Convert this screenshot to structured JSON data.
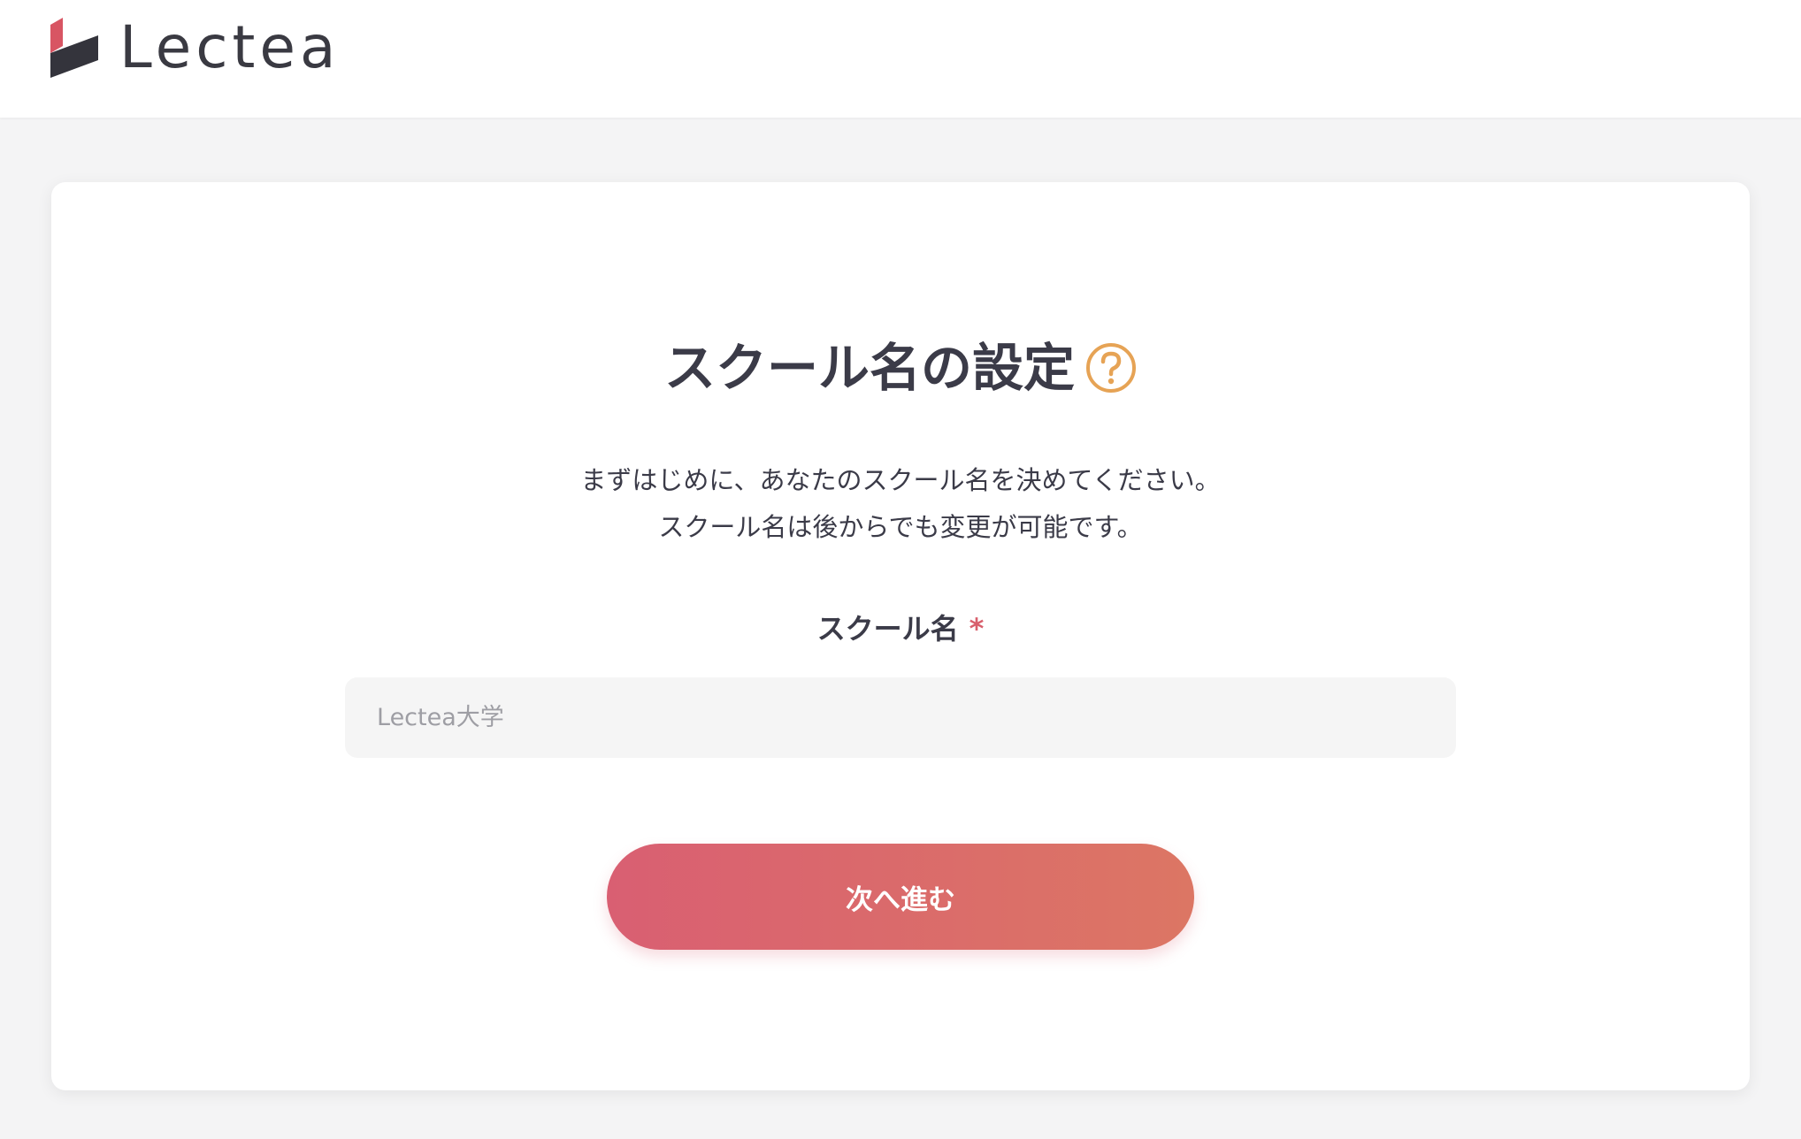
{
  "header": {
    "logo_text": "Lectea"
  },
  "main": {
    "title": "スクール名の設定",
    "description_lines": [
      "まずはじめに、あなたのスクール名を決めてください。",
      "スクール名は後からでも変更が可能です。"
    ],
    "field": {
      "label": "スクール名",
      "required_mark": "*",
      "placeholder": "Lectea大学",
      "value": ""
    },
    "next_button_label": "次へ進む"
  },
  "colors": {
    "accent_gradient_start": "#d95f72",
    "accent_gradient_end": "#dc7664",
    "help_icon": "#e6a355",
    "required": "#d85f6c",
    "text": "#3b3b48"
  },
  "icons": {
    "help": "question-circle-icon",
    "logo": "lectea-logo-icon"
  }
}
